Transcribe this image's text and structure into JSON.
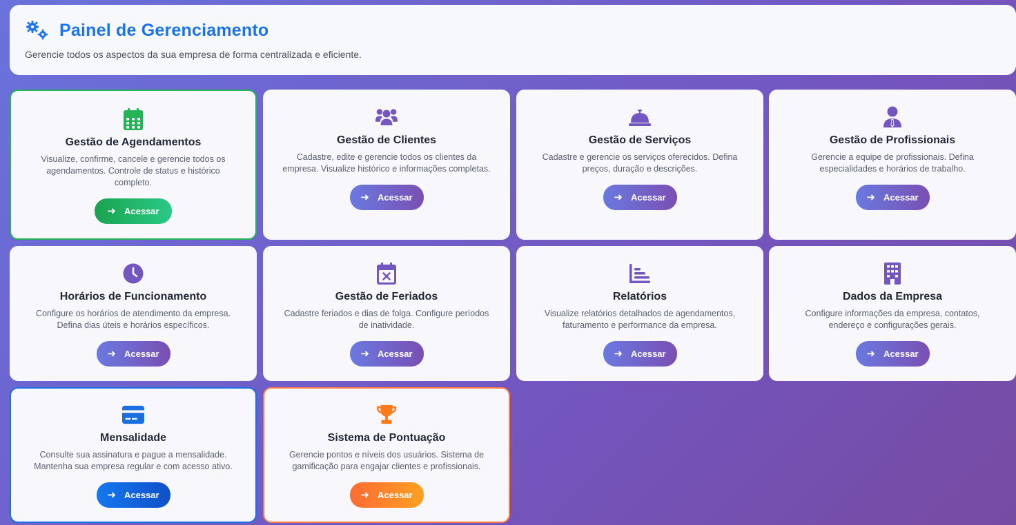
{
  "header": {
    "title": "Painel de Gerenciamento",
    "subtitle": "Gerencie todos os aspectos da sua empresa de forma centralizada e eficiente.",
    "icon": "gears-icon"
  },
  "colors": {
    "primary_blue": "#1a73e8",
    "purple": "#7356c0",
    "green": "#22b455",
    "orange": "#ff7a45"
  },
  "cards": [
    {
      "title": "Gestão de Agendamentos",
      "description": "Visualize, confirme, cancele e gerencie todos os agendamentos. Controle de status e histórico completo.",
      "button": "Acessar",
      "icon": "calendar-icon",
      "icon_color": "#22b455"
    },
    {
      "title": "Gestão de Clientes",
      "description": "Cadastre, edite e gerencie todos os clientes da empresa. Visualize histórico e informações completas.",
      "button": "Acessar",
      "icon": "users-icon",
      "icon_color": "#7356c0"
    },
    {
      "title": "Gestão de Serviços",
      "description": "Cadastre e gerencie os serviços oferecidos. Defina preços, duração e descrições.",
      "button": "Acessar",
      "icon": "service-bell-icon",
      "icon_color": "#7356c0"
    },
    {
      "title": "Gestão de Profissionais",
      "description": "Gerencie a equipe de profissionais. Defina especialidades e horários de trabalho.",
      "button": "Acessar",
      "icon": "user-tie-icon",
      "icon_color": "#7356c0"
    },
    {
      "title": "Horários de Funcionamento",
      "description": "Configure os horários de atendimento da empresa. Defina dias úteis e horários específicos.",
      "button": "Acessar",
      "icon": "clock-icon",
      "icon_color": "#7356c0"
    },
    {
      "title": "Gestão de Feriados",
      "description": "Cadastre feriados e dias de folga. Configure períodos de inatividade.",
      "button": "Acessar",
      "icon": "calendar-x-icon",
      "icon_color": "#7356c0"
    },
    {
      "title": "Relatórios",
      "description": "Visualize relatórios detalhados de agendamentos, faturamento e performance da empresa.",
      "button": "Acessar",
      "icon": "chart-icon",
      "icon_color": "#7356c0"
    },
    {
      "title": "Dados da Empresa",
      "description": "Configure informações da empresa, contatos, endereço e configurações gerais.",
      "button": "Acessar",
      "icon": "building-icon",
      "icon_color": "#7356c0"
    },
    {
      "title": "Mensalidade",
      "description": "Consulte sua assinatura e pague a mensalidade. Mantenha sua empresa regular e com acesso ativo.",
      "button": "Acessar",
      "icon": "credit-card-icon",
      "icon_color": "#1a6fe0"
    },
    {
      "title": "Sistema de Pontuação",
      "description": "Gerencie pontos e níveis dos usuários. Sistema de gamificação para engajar clientes e profissionais.",
      "button": "Acessar",
      "icon": "trophy-icon",
      "icon_color": "#ff7a1a"
    }
  ]
}
